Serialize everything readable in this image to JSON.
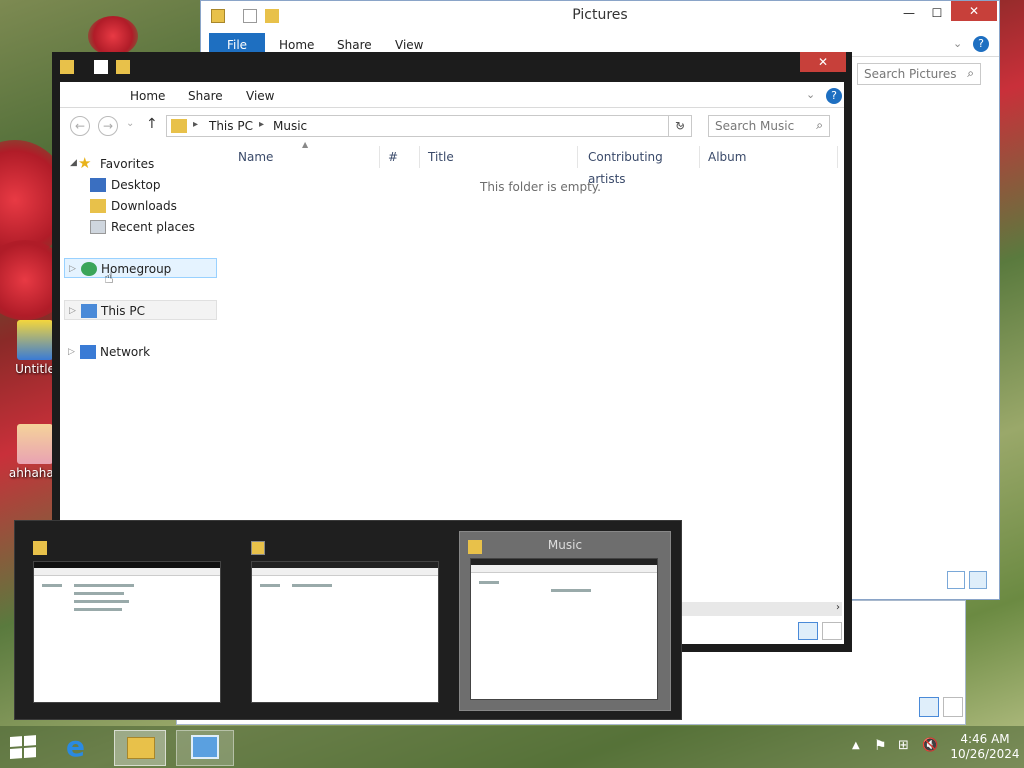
{
  "desktop": {
    "icons": [
      {
        "label": "Untitle"
      },
      {
        "label": "ahhahaa"
      }
    ]
  },
  "pictures_window": {
    "title": "Pictures",
    "tabs": [
      "File",
      "Home",
      "Share",
      "View"
    ],
    "search_placeholder": "Search Pictures",
    "controls": {
      "minimize": "—",
      "maximize": "☐",
      "close": "✕"
    }
  },
  "music_window": {
    "title": "Music",
    "tabs": [
      "Home",
      "Share",
      "View"
    ],
    "breadcrumb": [
      "This PC",
      "Music"
    ],
    "search_placeholder": "Search Music",
    "columns": [
      "Name",
      "#",
      "Title",
      "Contributing artists",
      "Album"
    ],
    "empty_message": "This folder is empty.",
    "close_glyph": "✕",
    "nav": {
      "favorites_label": "Favorites",
      "favorites": [
        "Desktop",
        "Downloads",
        "Recent places"
      ],
      "homegroup": "Homegroup",
      "this_pc": "This PC",
      "network": "Network"
    }
  },
  "task_switcher": {
    "items": [
      {
        "label": ""
      },
      {
        "label": ""
      },
      {
        "label": "Music",
        "selected": true
      }
    ]
  },
  "taskbar": {
    "time": "4:46 AM",
    "date": "10/26/2024"
  },
  "colors": {
    "ribbon_blue": "#1e6fc1",
    "close_red": "#c7403a",
    "switcher_bg": "#1f1f1f",
    "selection": "#cce8ff"
  }
}
